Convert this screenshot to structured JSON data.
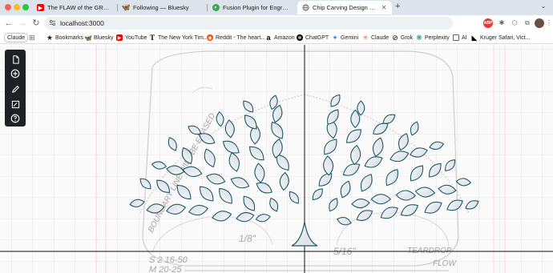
{
  "tabs": [
    {
      "title": "The FLAW of the GRENADIER...",
      "icon": "youtube-icon",
      "color": "#ff0000"
    },
    {
      "title": "Following — Bluesky",
      "icon": "bluesky-icon",
      "color": "#1185fe"
    },
    {
      "title": "Fusion Plugin for Engrave on...",
      "icon": "fusion-icon",
      "color": "#34a853"
    },
    {
      "title": "Chip Carving Design System",
      "icon": "globe-icon",
      "color": "#5f6368",
      "active": true
    }
  ],
  "address": {
    "url": "localhost:3000"
  },
  "bookmarks": [
    {
      "label": "Claude"
    },
    {
      "label": "Bookmarks"
    },
    {
      "label": "Bluesky"
    },
    {
      "label": "YouTube"
    },
    {
      "label": "The New York Tim..."
    },
    {
      "label": "Reddit - The heart..."
    },
    {
      "label": "Amazon"
    },
    {
      "label": "ChatGPT"
    },
    {
      "label": "Gemini"
    },
    {
      "label": "Claude"
    },
    {
      "label": "Grok"
    },
    {
      "label": "Perplexity"
    },
    {
      "label": "AI"
    },
    {
      "label": "Kruger Safari, Vict..."
    }
  ],
  "tools": [
    {
      "name": "new-document",
      "icon": "document-icon"
    },
    {
      "name": "add",
      "icon": "plus-circle-icon"
    },
    {
      "name": "draw",
      "icon": "pencil-icon"
    },
    {
      "name": "edit-image",
      "icon": "image-edit-icon"
    },
    {
      "name": "help",
      "icon": "question-icon"
    }
  ],
  "sketch": {
    "boundary_note": "BOUNDARY LINE WILL BE ERASED",
    "measure_1": "1/8\"",
    "measure_2": "5/16\"",
    "size_1": "S 2 16-50",
    "size_2": "M 20-25",
    "flow_1": "TEARDROP",
    "flow_2": "FLOW"
  }
}
